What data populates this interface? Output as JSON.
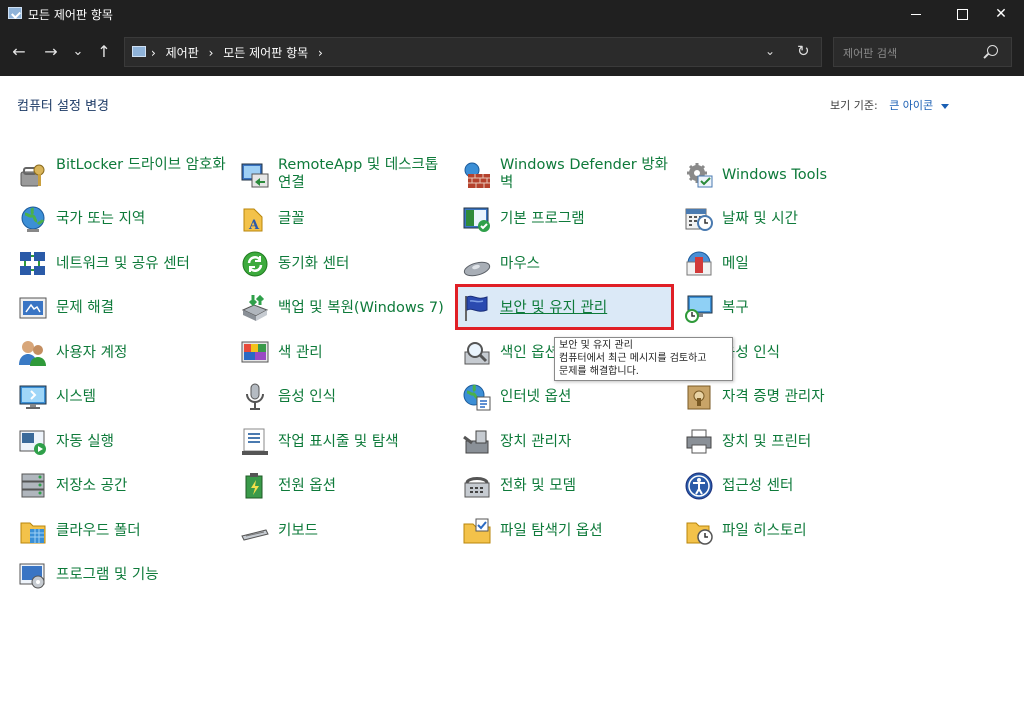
{
  "window": {
    "title": "모든 제어판 항목",
    "controls": {
      "minimize": "minimize",
      "maximize": "maximize",
      "close": "✕"
    }
  },
  "nav": {
    "back": "←",
    "forward": "→",
    "recent": "⌄",
    "up": "↑",
    "breadcrumbs": [
      "›",
      "제어판",
      "›",
      "모든 제어판 항목",
      "›"
    ],
    "dropdown": "⌄",
    "refresh": "↻",
    "search_placeholder": "제어판 검색"
  },
  "header": {
    "title": "컴퓨터 설정 변경",
    "view_by_label": "보기 기준:",
    "view_by_value": "큰 아이콘"
  },
  "items": [
    {
      "label": "BitLocker 드라이브 암호화",
      "icon": "bitlocker-icon"
    },
    {
      "label": "RemoteApp 및 데스크톱 연결",
      "icon": "remoteapp-icon"
    },
    {
      "label": "Windows Defender 방화벽",
      "icon": "firewall-icon"
    },
    {
      "label": "Windows Tools",
      "icon": "windows-tools-icon"
    },
    {
      "label": "국가 또는 지역",
      "icon": "region-icon"
    },
    {
      "label": "글꼴",
      "icon": "fonts-icon"
    },
    {
      "label": "기본 프로그램",
      "icon": "default-programs-icon"
    },
    {
      "label": "날짜 및 시간",
      "icon": "date-time-icon"
    },
    {
      "label": "네트워크 및 공유 센터",
      "icon": "network-icon"
    },
    {
      "label": "동기화 센터",
      "icon": "sync-center-icon"
    },
    {
      "label": "마우스",
      "icon": "mouse-icon"
    },
    {
      "label": "메일",
      "icon": "mail-icon"
    },
    {
      "label": "문제 해결",
      "icon": "troubleshooting-icon"
    },
    {
      "label": "백업 및 복원(Windows 7)",
      "icon": "backup-icon"
    },
    {
      "label": "보안 및 유지 관리",
      "icon": "security-flag-icon"
    },
    {
      "label": "복구",
      "icon": "recovery-icon"
    },
    {
      "label": "사용자 계정",
      "icon": "user-accounts-icon"
    },
    {
      "label": "색 관리",
      "icon": "color-management-icon"
    },
    {
      "label": "색인 옵션",
      "icon": "indexing-icon"
    },
    {
      "label": "음성 인식",
      "icon": "speech-icon"
    },
    {
      "label": "시스템",
      "icon": "system-icon"
    },
    {
      "label": "음성 인식",
      "icon": "microphone-icon"
    },
    {
      "label": "인터넷 옵션",
      "icon": "internet-options-icon"
    },
    {
      "label": "자격 증명 관리자",
      "icon": "credential-icon"
    },
    {
      "label": "자동 실행",
      "icon": "autoplay-icon"
    },
    {
      "label": "작업 표시줄 및 탐색",
      "icon": "taskbar-icon"
    },
    {
      "label": "장치 관리자",
      "icon": "device-manager-icon"
    },
    {
      "label": "장치 및 프린터",
      "icon": "printer-icon"
    },
    {
      "label": "저장소 공간",
      "icon": "storage-icon"
    },
    {
      "label": "전원 옵션",
      "icon": "power-icon"
    },
    {
      "label": "전화 및 모뎀",
      "icon": "phone-icon"
    },
    {
      "label": "접근성 센터",
      "icon": "accessibility-icon"
    },
    {
      "label": "클라우드 폴더",
      "icon": "cloud-folder-icon"
    },
    {
      "label": "키보드",
      "icon": "keyboard-icon"
    },
    {
      "label": "파일 탐색기 옵션",
      "icon": "folder-options-icon"
    },
    {
      "label": "파일 히스토리",
      "icon": "file-history-icon"
    },
    {
      "label": "프로그램 및 기능",
      "icon": "programs-icon"
    }
  ],
  "tooltip": {
    "title": "보안 및 유지 관리",
    "line1": "컴퓨터에서 최근 메시지를 검토하고",
    "line2": "문제를 해결합니다."
  }
}
